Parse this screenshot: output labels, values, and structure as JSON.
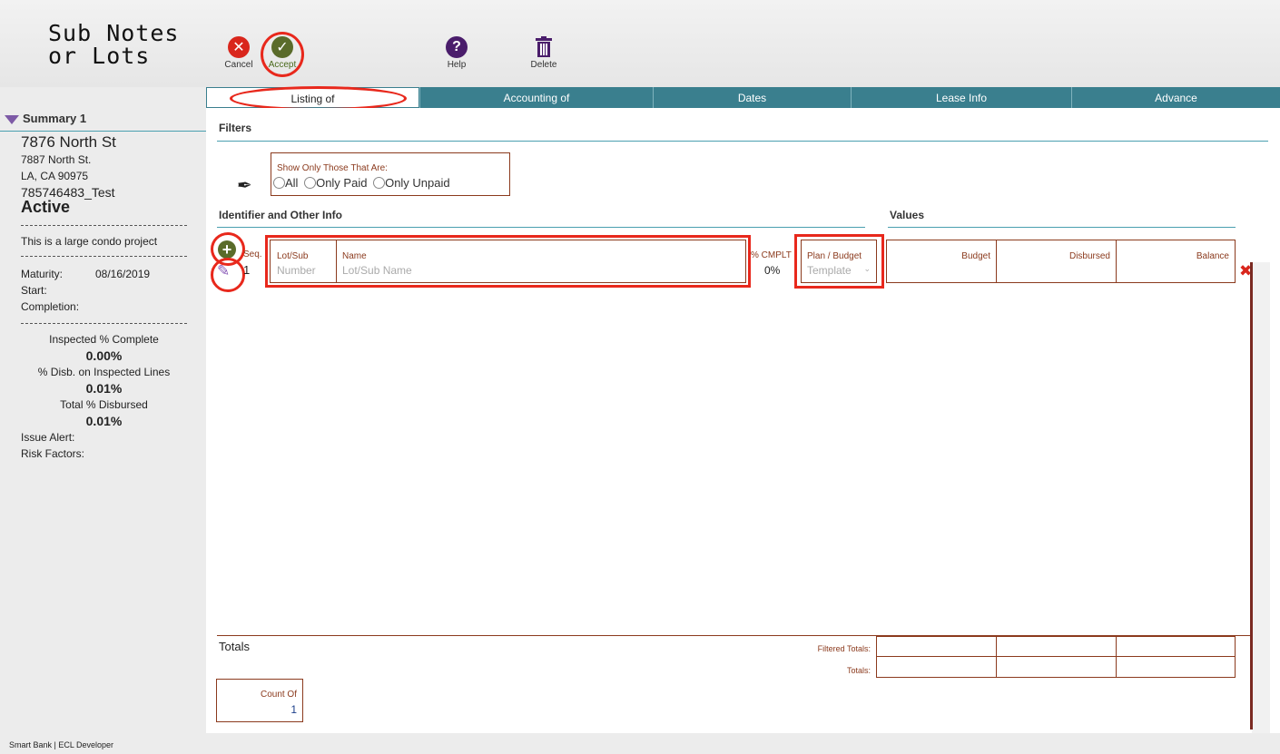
{
  "app": {
    "title_line1": "Sub Notes",
    "title_line2": "or Lots"
  },
  "toolbar": {
    "cancel": "Cancel",
    "accept": "Accept",
    "help": "Help",
    "delete": "Delete"
  },
  "tabs": [
    "Listing of",
    "Accounting of",
    "Dates",
    "Lease Info",
    "Advance"
  ],
  "summary": {
    "heading": "Summary 1",
    "name": "7876 North St",
    "addr1": "7887 North St.",
    "addr2": "LA, CA  90975",
    "loan_id": "785746483_Test",
    "status": "Active",
    "description": "This is a large condo project",
    "maturity_label": "Maturity:",
    "maturity_value": "08/16/2019",
    "start_label": "Start:",
    "completion_label": "Completion:",
    "inspected_label": "Inspected % Complete",
    "inspected_value": "0.00%",
    "disb_insp_label": "% Disb. on Inspected Lines",
    "disb_insp_value": "0.01%",
    "total_disb_label": "Total % Disbursed",
    "total_disb_value": "0.01%",
    "issue_label": "Issue Alert:",
    "risk_label": "Risk Factors:"
  },
  "filters": {
    "heading": "Filters",
    "group_label": "Show Only Those That Are:",
    "options": [
      "All",
      "Only Paid",
      "Only Unpaid"
    ]
  },
  "identifier": {
    "heading": "Identifier and Other Info"
  },
  "values_section": {
    "heading": "Values"
  },
  "row": {
    "seq_label": "Seq.",
    "seq_value": "1",
    "lot_label": "Lot/Sub",
    "lot_placeholder": "Number",
    "name_label": "Name",
    "name_placeholder": "Lot/Sub Name",
    "cmplt_label": "% CMPLT",
    "cmplt_value": "0%",
    "plan_label": "Plan / Budget",
    "plan_placeholder": "Template",
    "budget_label": "Budget",
    "disbursed_label": "Disbursed",
    "balance_label": "Balance"
  },
  "totals": {
    "heading": "Totals",
    "filtered_label": "Filtered Totals:",
    "totals_label": "Totals:",
    "count_label": "Count Of",
    "count_value": "1"
  },
  "footer": {
    "text": "Smart Bank | ECL Developer"
  }
}
